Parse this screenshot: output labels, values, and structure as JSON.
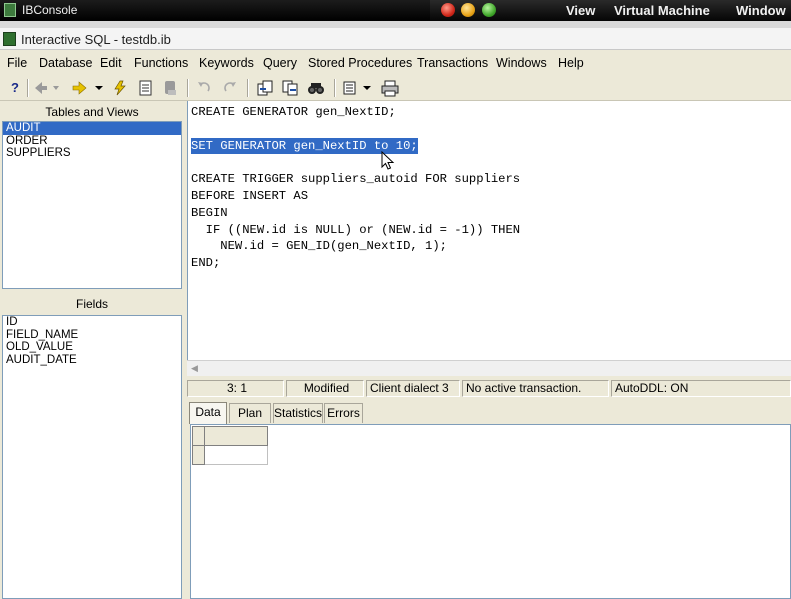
{
  "mac_bar": {
    "app_name": "IBConsole",
    "menus": [
      "View",
      "Virtual Machine",
      "Window"
    ]
  },
  "window": {
    "title": "Interactive SQL - testdb.ib"
  },
  "menubar": {
    "items": [
      "File",
      "Database",
      "Edit",
      "Functions",
      "Keywords",
      "Query",
      "Stored Procedures",
      "Transactions",
      "Windows",
      "Help"
    ]
  },
  "toolbar": {
    "icons": [
      "help-icon",
      "previous-query-icon",
      "next-query-icon",
      "execute-icon",
      "prepare-icon",
      "commit-icon",
      "undo-icon",
      "redo-icon",
      "load-script-icon",
      "save-script-icon",
      "find-icon",
      "options-icon",
      "print-icon"
    ],
    "help_glyph": "?"
  },
  "tables_panel": {
    "header": "Tables and Views",
    "items": [
      "AUDIT",
      "ORDER",
      "SUPPLIERS"
    ],
    "selected_index": 0
  },
  "fields_panel": {
    "header": "Fields",
    "items": [
      "ID",
      "FIELD_NAME",
      "OLD_VALUE",
      "AUDIT_DATE"
    ]
  },
  "editor": {
    "lines": [
      "CREATE GENERATOR gen_NextID;",
      "",
      "SET GENERATOR gen_NextID to 10;",
      "",
      "CREATE TRIGGER suppliers_autoid FOR suppliers",
      "BEFORE INSERT AS",
      "BEGIN",
      "  IF ((NEW.id is NULL) or (NEW.id = -1)) THEN",
      "    NEW.id = GEN_ID(gen_NextID, 1);",
      "END;"
    ],
    "highlighted_line": 2
  },
  "statusbar": {
    "position": "3: 1",
    "modified": "Modified",
    "dialect": "Client dialect 3",
    "transaction": "No active transaction.",
    "autoddl": "AutoDDL: ON"
  },
  "tabs": [
    "Data",
    "Plan",
    "Statistics",
    "Errors"
  ],
  "active_tab": 0,
  "colors": {
    "selection": "#316ac5",
    "chrome": "#ece9d8"
  }
}
